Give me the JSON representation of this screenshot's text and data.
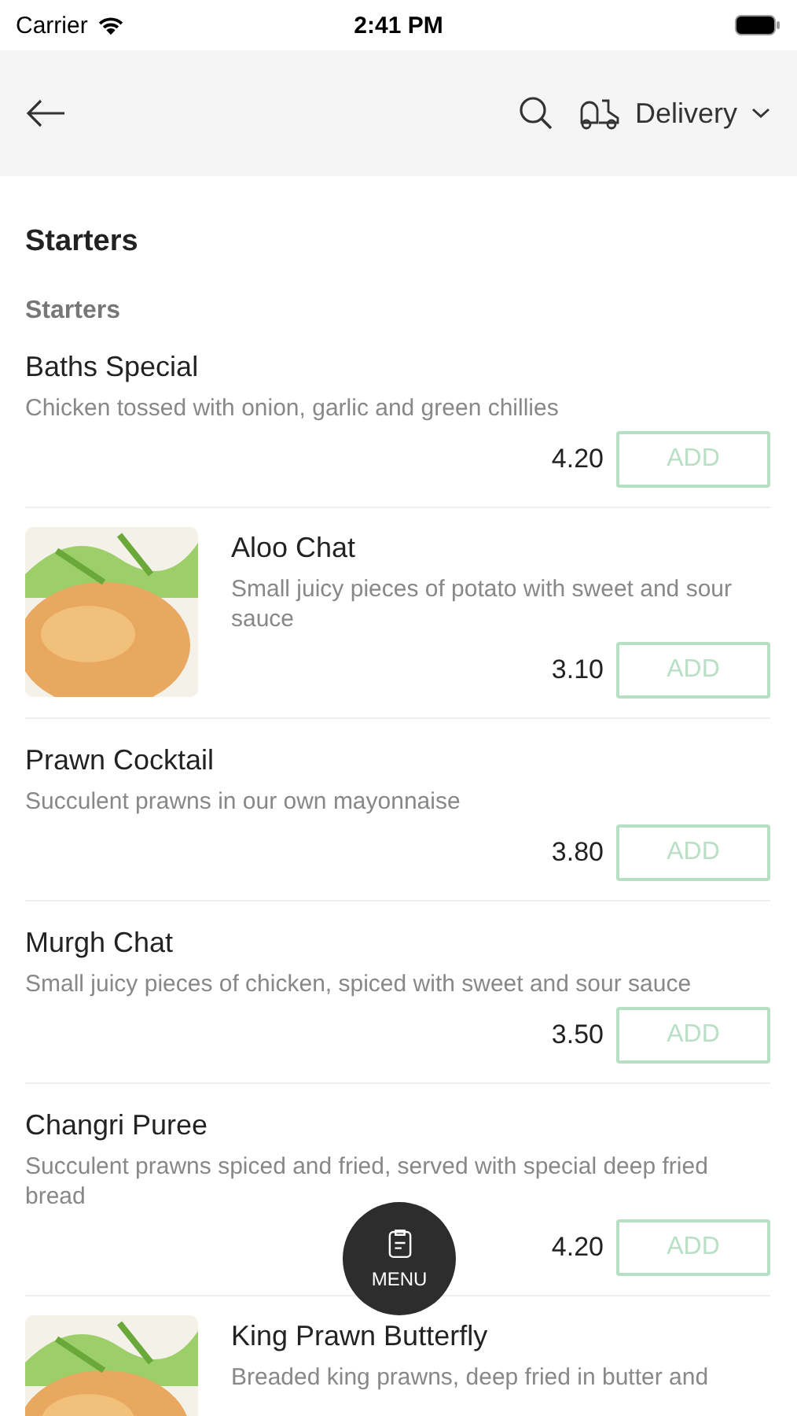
{
  "status_bar": {
    "carrier": "Carrier",
    "time": "2:41 PM"
  },
  "header": {
    "delivery_label": "Delivery"
  },
  "section": {
    "title": "Starters",
    "subtitle": "Starters"
  },
  "items": [
    {
      "name": "Baths Special",
      "description": "Chicken tossed with onion, garlic and green chillies",
      "price": "4.20",
      "button": "ADD",
      "kind": "plain"
    },
    {
      "name": "Aloo Chat",
      "description": "Small juicy pieces of potato with sweet and sour sauce",
      "price": "3.10",
      "button": "ADD",
      "kind": "picture"
    },
    {
      "name": "Prawn Cocktail",
      "description": "Succulent prawns in our own mayonnaise",
      "price": "3.80",
      "button": "ADD",
      "kind": "plain"
    },
    {
      "name": "Murgh Chat",
      "description": "Small juicy pieces of chicken, spiced with sweet and sour sauce",
      "price": "3.50",
      "button": "ADD",
      "kind": "plain"
    },
    {
      "name": "Changri Puree",
      "description": "Succulent prawns spiced and fried, served with special deep fried bread",
      "price": "4.20",
      "button": "ADD",
      "kind": "plain"
    },
    {
      "name": "King Prawn Butterfly",
      "description": "Breaded king prawns, deep fried in butter and",
      "kind": "picture"
    }
  ],
  "menu_button": {
    "label": "MENU"
  }
}
